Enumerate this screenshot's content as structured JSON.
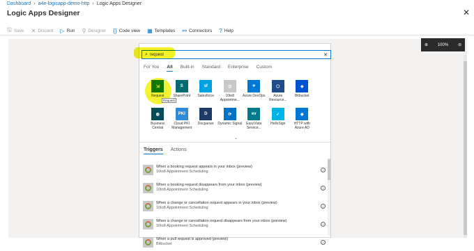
{
  "breadcrumb": [
    "Dashboard",
    "a4e-logicapp-demo-http",
    "Logic Apps Designer"
  ],
  "title": "Logic Apps Designer",
  "toolbar": [
    {
      "label": "Save",
      "icon": "save-icon",
      "glyph": "🖫",
      "enabled": false
    },
    {
      "label": "Discard",
      "icon": "discard-icon",
      "glyph": "✕",
      "enabled": false
    },
    {
      "label": "Run",
      "icon": "run-icon",
      "glyph": "▷",
      "enabled": true
    },
    {
      "label": "Designer",
      "icon": "designer-icon",
      "glyph": "⚲",
      "enabled": false
    },
    {
      "label": "Code view",
      "icon": "code-icon",
      "glyph": "{}",
      "enabled": true
    },
    {
      "label": "Templates",
      "icon": "templates-icon",
      "glyph": "▦",
      "enabled": true
    },
    {
      "label": "Connectors",
      "icon": "connectors-icon",
      "glyph": "⚯",
      "enabled": true
    },
    {
      "label": "Help",
      "icon": "help-icon",
      "glyph": "?",
      "enabled": true
    }
  ],
  "zoom": {
    "level": "100%"
  },
  "search": {
    "value": "request"
  },
  "filters": [
    "For You",
    "All",
    "Built-in",
    "Standard",
    "Enterprise",
    "Custom"
  ],
  "active_filter": "All",
  "tooltip": "Request",
  "connectors": [
    {
      "label": "Request",
      "color": "#107c10",
      "glyph": "⇲"
    },
    {
      "label": "SharePoint",
      "color": "#036c70",
      "glyph": "S"
    },
    {
      "label": "Salesforce",
      "color": "#00a1e0",
      "glyph": "sf"
    },
    {
      "label": "10to8 Appointme...",
      "color": "#c8c8c8",
      "glyph": "◎"
    },
    {
      "label": "Azure DevOps",
      "color": "#0078d4",
      "glyph": "⌗"
    },
    {
      "label": "Azure Resource...",
      "color": "#1e4d8c",
      "glyph": "⬡"
    },
    {
      "label": "Bitbucket",
      "color": "#0052cc",
      "glyph": "◈"
    },
    {
      "label": "Business Central",
      "color": "#054b58",
      "glyph": "◍"
    },
    {
      "label": "Cloud PKI Management",
      "color": "#2e8bd8",
      "glyph": "PKI"
    },
    {
      "label": "Docparser",
      "color": "#1b3a66",
      "glyph": "D"
    },
    {
      "label": "Dynamic Signal",
      "color": "#0072c6",
      "glyph": "⟳"
    },
    {
      "label": "EasyVista Service...",
      "color": "#007a8a",
      "glyph": "ev"
    },
    {
      "label": "HelloSign",
      "color": "#00b3e6",
      "glyph": "✓"
    },
    {
      "label": "HTTP with Azure AD",
      "color": "#0078d4",
      "glyph": "◆"
    }
  ],
  "tabs2": [
    "Triggers",
    "Actions"
  ],
  "active_tab2": "Triggers",
  "triggers": [
    {
      "title": "When a booking request appears in your inbox (preview)",
      "sub": "10to8 Appointment Scheduling"
    },
    {
      "title": "When a booking request disappears from your inbox (preview)",
      "sub": "10to8 Appointment Scheduling"
    },
    {
      "title": "When a change or cancellation request appears in your inbox (preview)",
      "sub": "10to8 Appointment Scheduling"
    },
    {
      "title": "When a change or cancellation request disappears from your inbox (preview)",
      "sub": "10to8 Appointment Scheduling"
    },
    {
      "title": "When a pull request is approved (preview)",
      "sub": "Bitbucket"
    }
  ]
}
